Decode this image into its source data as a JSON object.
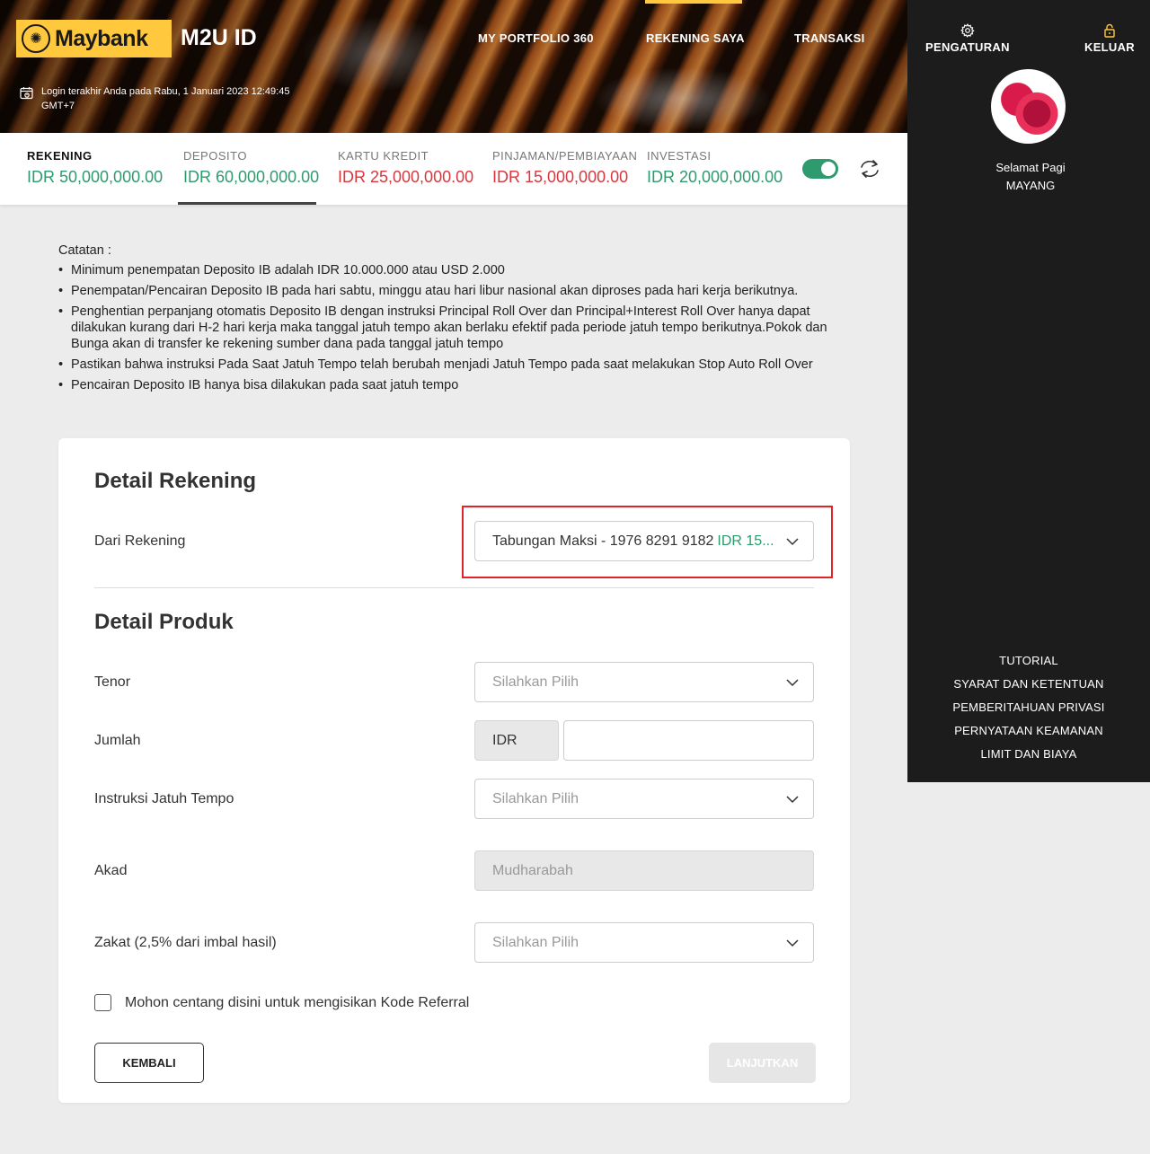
{
  "header": {
    "brand": "Maybank",
    "app_title": "M2U ID",
    "login_info": "Login terakhir Anda pada Rabu, 1 Januari 2023 12:49:45 GMT+7",
    "nav": [
      {
        "label": "MY PORTFOLIO 360",
        "active": false
      },
      {
        "label": "REKENING SAYA",
        "active": true
      },
      {
        "label": "TRANSAKSI",
        "active": false
      }
    ],
    "accent_color": "#ffc83d"
  },
  "sidebar": {
    "settings_label": "PENGATURAN",
    "logout_label": "KELUAR",
    "greeting": "Selamat Pagi",
    "user_name": "MAYANG",
    "footer_links": [
      "TUTORIAL",
      "SYARAT DAN KETENTUAN",
      "PEMBERITAHUAN PRIVASI",
      "PERNYATAAN KEAMANAN",
      "LIMIT DAN BIAYA"
    ]
  },
  "summary": {
    "items": [
      {
        "label": "REKENING",
        "value": "IDR 50,000,000.00",
        "color": "green"
      },
      {
        "label": "DEPOSITO",
        "value": "IDR 60,000,000.00",
        "color": "green"
      },
      {
        "label": "KARTU KREDIT",
        "value": "IDR 25,000,000.00",
        "color": "red"
      },
      {
        "label": "PINJAMAN/PEMBIAYAAN",
        "value": "IDR 15,000,000.00",
        "color": "red"
      },
      {
        "label": "INVESTASI",
        "value": "IDR 20,000,000.00",
        "color": "green"
      }
    ],
    "toggle_on": true
  },
  "notes": {
    "title": "Catatan :",
    "items": [
      "Minimum penempatan Deposito IB adalah IDR 10.000.000 atau USD 2.000",
      "Penempatan/Pencairan Deposito IB pada hari sabtu, minggu atau hari libur nasional akan diproses pada hari kerja berikutnya.",
      "Penghentian perpanjang otomatis Deposito IB dengan instruksi Principal Roll Over dan Principal+Interest Roll Over hanya dapat dilakukan kurang dari H-2 hari kerja maka tanggal jatuh tempo akan berlaku efektif pada periode jatuh tempo berikutnya.Pokok dan Bunga akan di transfer ke rekening sumber dana pada tanggal jatuh tempo",
      "Pastikan bahwa instruksi Pada Saat Jatuh Tempo telah berubah menjadi Jatuh Tempo pada saat melakukan Stop Auto Roll Over",
      "Pencairan Deposito IB hanya bisa dilakukan pada saat jatuh tempo"
    ]
  },
  "form": {
    "account_section_title": "Detail Rekening",
    "from_account_label": "Dari Rekening",
    "from_account_value": "Tabungan Maksi - 1976 8291 9182",
    "from_account_balance": "IDR 15...",
    "product_section_title": "Detail Produk",
    "tenor_label": "Tenor",
    "tenor_placeholder": "Silahkan Pilih",
    "amount_label": "Jumlah",
    "currency": "IDR",
    "amount_value": "",
    "maturity_label": "Instruksi Jatuh Tempo",
    "maturity_placeholder": "Silahkan Pilih",
    "akad_label": "Akad",
    "akad_value": "Mudharabah",
    "zakat_label": "Zakat (2,5% dari imbal hasil)",
    "zakat_placeholder": "Silahkan Pilih",
    "referral_label": "Mohon centang disini untuk mengisikan Kode Referral",
    "referral_checked": false,
    "back_button": "KEMBALI",
    "next_button": "LANJUTKAN"
  }
}
